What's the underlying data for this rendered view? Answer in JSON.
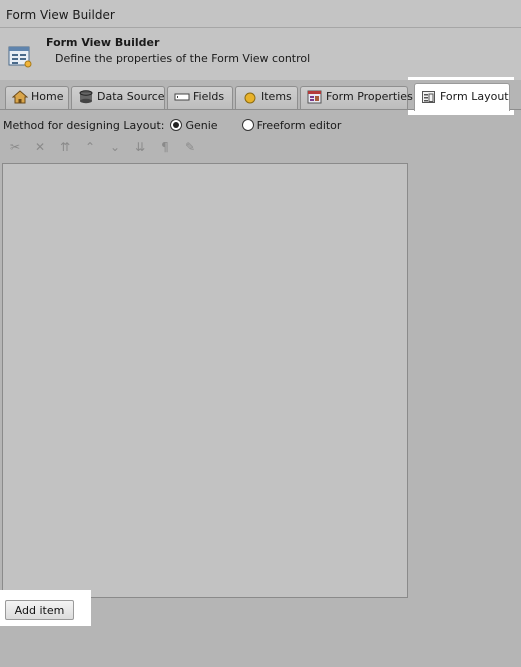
{
  "window": {
    "title": "Form View Builder"
  },
  "header": {
    "title": "Form View Builder",
    "subtitle": "Define the properties of the Form View control",
    "icon": "form-grid-icon"
  },
  "tabs": [
    {
      "label": "Home",
      "icon": "house-icon"
    },
    {
      "label": "Data Source",
      "icon": "database-icon"
    },
    {
      "label": "Fields",
      "icon": "field-icon"
    },
    {
      "label": "Items",
      "icon": "yellow-circle-icon"
    },
    {
      "label": "Form Properties",
      "icon": "form-properties-icon"
    },
    {
      "label": "Form Layout",
      "icon": "form-layout-icon",
      "active": true
    }
  ],
  "method": {
    "label": "Method for designing Layout:",
    "options": [
      {
        "label": "Genie",
        "selected": true
      },
      {
        "label": "Freeform editor",
        "selected": false
      }
    ]
  },
  "toolbar": {
    "buttons": [
      {
        "name": "cut-icon",
        "glyph": "✂"
      },
      {
        "name": "delete-icon",
        "glyph": "✕"
      },
      {
        "name": "move-top-icon",
        "glyph": "⇈"
      },
      {
        "name": "move-up-icon",
        "glyph": "⌃"
      },
      {
        "name": "move-down-icon",
        "glyph": "⌄"
      },
      {
        "name": "move-bottom-icon",
        "glyph": "⇊"
      },
      {
        "name": "paragraph-icon",
        "glyph": "¶"
      },
      {
        "name": "edit-item-icon",
        "glyph": "✎"
      }
    ]
  },
  "actions": {
    "add_item": "Add item"
  },
  "colors": {
    "background": "#b5b5b5",
    "active_tab": "#ffffff",
    "highlight": "#ffffff"
  }
}
